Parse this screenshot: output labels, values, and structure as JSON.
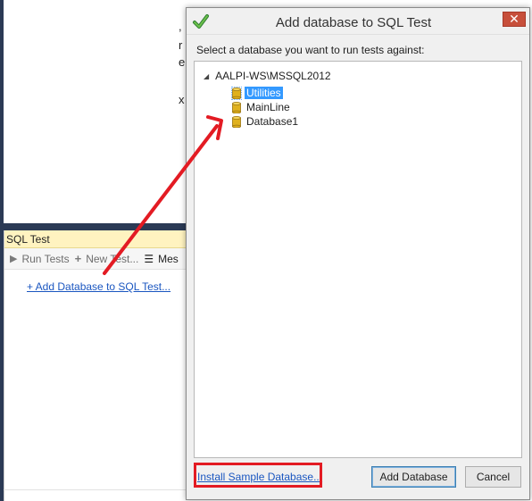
{
  "background": {
    "doc_fragments": [
      ",",
      "r",
      "e"
    ],
    "doc_x_glyph": "x",
    "panel": {
      "title": "SQL Test",
      "toolbar": {
        "run_label": "Run Tests",
        "new_label": "New Test...",
        "more_label": "Mes"
      },
      "add_link": "+ Add Database to SQL Test..."
    }
  },
  "dialog": {
    "title": "Add database to SQL Test",
    "close_glyph": "✕",
    "prompt": "Select a database you want to run tests against:",
    "server": "AALPI-WS\\MSSQL2012",
    "databases": [
      {
        "name": "Utilities",
        "selected": true
      },
      {
        "name": "MainLine",
        "selected": false
      },
      {
        "name": "Database1",
        "selected": false
      }
    ],
    "install_link": "Install Sample Database...",
    "add_button": "Add Database",
    "cancel_button": "Cancel"
  },
  "icons": {
    "title": "green-check-icon",
    "database": "database-cylinder-icon",
    "run": "play-icon",
    "new": "plus-icon",
    "more": "list-icon"
  },
  "colors": {
    "panel_title_bg": "#fff3c0",
    "link": "#1a56c0",
    "selection": "#3399ff",
    "close_button": "#c74f3b",
    "annotation_red": "#e31b23",
    "db_icon": "#e0b11e"
  }
}
